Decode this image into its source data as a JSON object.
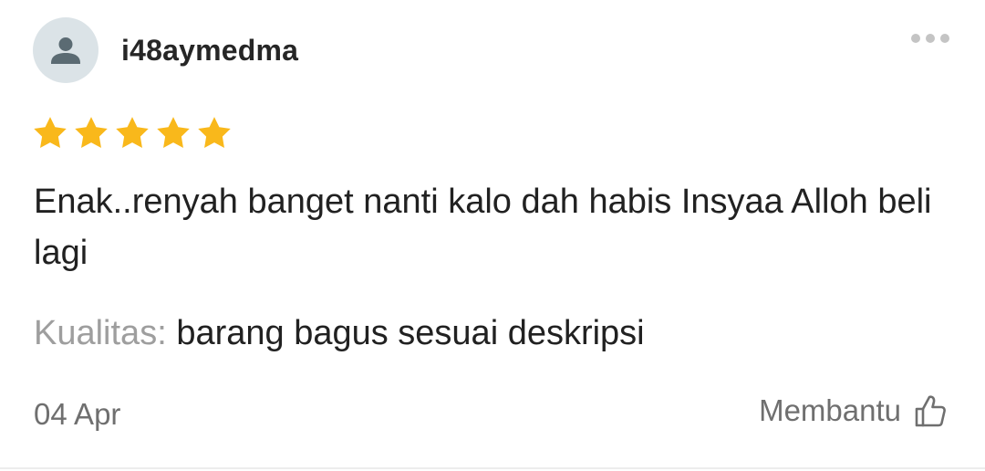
{
  "review": {
    "avatar_icon": "user-silhouette-icon",
    "username": "i48aymedma",
    "more_icon": "more-horizontal-icon",
    "rating": 5,
    "rating_max": 5,
    "star_color": "#f9b81b",
    "comment": "Enak..renyah banget nanti kalo dah habis Insyaa Alloh beli lagi",
    "quality_label": "Kualitas:",
    "quality_value": "barang bagus sesuai deskripsi",
    "date": "04 Apr",
    "helpful_label": "Membantu",
    "helpful_icon": "thumbs-up-outline-icon"
  }
}
